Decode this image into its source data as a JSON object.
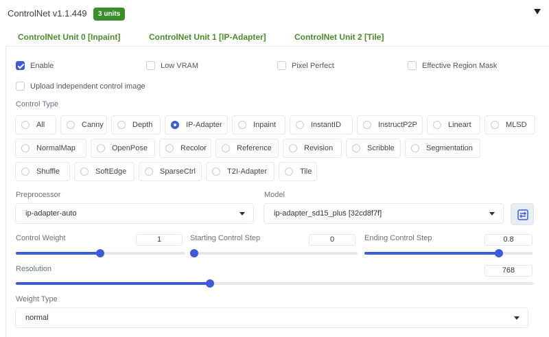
{
  "header": {
    "title": "ControlNet v1.1.449",
    "units_badge": "3 units"
  },
  "tabs": [
    {
      "label": "ControlNet Unit 0 [Inpaint]"
    },
    {
      "label": "ControlNet Unit 1 [IP-Adapter]"
    },
    {
      "label": "ControlNet Unit 2 [Tile]"
    }
  ],
  "options": {
    "enable": {
      "label": "Enable",
      "checked": true
    },
    "low_vram": {
      "label": "Low VRAM",
      "checked": false
    },
    "pixel_perfect": {
      "label": "Pixel Perfect",
      "checked": false
    },
    "effective_region_mask": {
      "label": "Effective Region Mask",
      "checked": false
    },
    "upload_independent": {
      "label": "Upload independent control image",
      "checked": false
    }
  },
  "control_type": {
    "label": "Control Type",
    "selected": "IP-Adapter",
    "items": [
      "All",
      "Canny",
      "Depth",
      "IP-Adapter",
      "Inpaint",
      "InstantID",
      "InstructP2P",
      "Lineart",
      "MLSD",
      "NormalMap",
      "OpenPose",
      "Recolor",
      "Reference",
      "Revision",
      "Scribble",
      "Segmentation",
      "Shuffle",
      "SoftEdge",
      "SparseCtrl",
      "T2I-Adapter",
      "Tile"
    ]
  },
  "preprocessor": {
    "label": "Preprocessor",
    "value": "ip-adapter-auto"
  },
  "model": {
    "label": "Model",
    "value": "ip-adapter_sd15_plus [32cd8f7f]",
    "refresh_icon": "refresh-icon"
  },
  "control_weight": {
    "label": "Control Weight",
    "value": "1",
    "min": 0,
    "max": 2
  },
  "starting_step": {
    "label": "Starting Control Step",
    "value": "0",
    "min": 0,
    "max": 1
  },
  "ending_step": {
    "label": "Ending Control Step",
    "value": "0.8",
    "min": 0,
    "max": 1
  },
  "resolution": {
    "label": "Resolution",
    "value": "768",
    "min": 0,
    "max": 2048
  },
  "weight_type": {
    "label": "Weight Type",
    "value": "normal"
  },
  "colors": {
    "accent": "#3b5bdb",
    "badge": "#3a8e2b",
    "tab_text": "#4a8c2a"
  }
}
